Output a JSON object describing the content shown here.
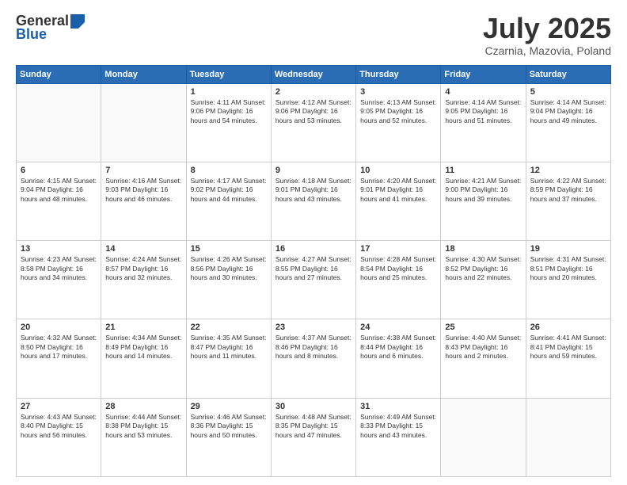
{
  "header": {
    "logo_general": "General",
    "logo_blue": "Blue",
    "title": "July 2025",
    "location": "Czarnia, Mazovia, Poland"
  },
  "calendar": {
    "days": [
      "Sunday",
      "Monday",
      "Tuesday",
      "Wednesday",
      "Thursday",
      "Friday",
      "Saturday"
    ],
    "weeks": [
      [
        {
          "date": "",
          "info": ""
        },
        {
          "date": "",
          "info": ""
        },
        {
          "date": "1",
          "info": "Sunrise: 4:11 AM\nSunset: 9:06 PM\nDaylight: 16 hours\nand 54 minutes."
        },
        {
          "date": "2",
          "info": "Sunrise: 4:12 AM\nSunset: 9:06 PM\nDaylight: 16 hours\nand 53 minutes."
        },
        {
          "date": "3",
          "info": "Sunrise: 4:13 AM\nSunset: 9:05 PM\nDaylight: 16 hours\nand 52 minutes."
        },
        {
          "date": "4",
          "info": "Sunrise: 4:14 AM\nSunset: 9:05 PM\nDaylight: 16 hours\nand 51 minutes."
        },
        {
          "date": "5",
          "info": "Sunrise: 4:14 AM\nSunset: 9:04 PM\nDaylight: 16 hours\nand 49 minutes."
        }
      ],
      [
        {
          "date": "6",
          "info": "Sunrise: 4:15 AM\nSunset: 9:04 PM\nDaylight: 16 hours\nand 48 minutes."
        },
        {
          "date": "7",
          "info": "Sunrise: 4:16 AM\nSunset: 9:03 PM\nDaylight: 16 hours\nand 46 minutes."
        },
        {
          "date": "8",
          "info": "Sunrise: 4:17 AM\nSunset: 9:02 PM\nDaylight: 16 hours\nand 44 minutes."
        },
        {
          "date": "9",
          "info": "Sunrise: 4:18 AM\nSunset: 9:01 PM\nDaylight: 16 hours\nand 43 minutes."
        },
        {
          "date": "10",
          "info": "Sunrise: 4:20 AM\nSunset: 9:01 PM\nDaylight: 16 hours\nand 41 minutes."
        },
        {
          "date": "11",
          "info": "Sunrise: 4:21 AM\nSunset: 9:00 PM\nDaylight: 16 hours\nand 39 minutes."
        },
        {
          "date": "12",
          "info": "Sunrise: 4:22 AM\nSunset: 8:59 PM\nDaylight: 16 hours\nand 37 minutes."
        }
      ],
      [
        {
          "date": "13",
          "info": "Sunrise: 4:23 AM\nSunset: 8:58 PM\nDaylight: 16 hours\nand 34 minutes."
        },
        {
          "date": "14",
          "info": "Sunrise: 4:24 AM\nSunset: 8:57 PM\nDaylight: 16 hours\nand 32 minutes."
        },
        {
          "date": "15",
          "info": "Sunrise: 4:26 AM\nSunset: 8:56 PM\nDaylight: 16 hours\nand 30 minutes."
        },
        {
          "date": "16",
          "info": "Sunrise: 4:27 AM\nSunset: 8:55 PM\nDaylight: 16 hours\nand 27 minutes."
        },
        {
          "date": "17",
          "info": "Sunrise: 4:28 AM\nSunset: 8:54 PM\nDaylight: 16 hours\nand 25 minutes."
        },
        {
          "date": "18",
          "info": "Sunrise: 4:30 AM\nSunset: 8:52 PM\nDaylight: 16 hours\nand 22 minutes."
        },
        {
          "date": "19",
          "info": "Sunrise: 4:31 AM\nSunset: 8:51 PM\nDaylight: 16 hours\nand 20 minutes."
        }
      ],
      [
        {
          "date": "20",
          "info": "Sunrise: 4:32 AM\nSunset: 8:50 PM\nDaylight: 16 hours\nand 17 minutes."
        },
        {
          "date": "21",
          "info": "Sunrise: 4:34 AM\nSunset: 8:49 PM\nDaylight: 16 hours\nand 14 minutes."
        },
        {
          "date": "22",
          "info": "Sunrise: 4:35 AM\nSunset: 8:47 PM\nDaylight: 16 hours\nand 11 minutes."
        },
        {
          "date": "23",
          "info": "Sunrise: 4:37 AM\nSunset: 8:46 PM\nDaylight: 16 hours\nand 8 minutes."
        },
        {
          "date": "24",
          "info": "Sunrise: 4:38 AM\nSunset: 8:44 PM\nDaylight: 16 hours\nand 6 minutes."
        },
        {
          "date": "25",
          "info": "Sunrise: 4:40 AM\nSunset: 8:43 PM\nDaylight: 16 hours\nand 2 minutes."
        },
        {
          "date": "26",
          "info": "Sunrise: 4:41 AM\nSunset: 8:41 PM\nDaylight: 15 hours\nand 59 minutes."
        }
      ],
      [
        {
          "date": "27",
          "info": "Sunrise: 4:43 AM\nSunset: 8:40 PM\nDaylight: 15 hours\nand 56 minutes."
        },
        {
          "date": "28",
          "info": "Sunrise: 4:44 AM\nSunset: 8:38 PM\nDaylight: 15 hours\nand 53 minutes."
        },
        {
          "date": "29",
          "info": "Sunrise: 4:46 AM\nSunset: 8:36 PM\nDaylight: 15 hours\nand 50 minutes."
        },
        {
          "date": "30",
          "info": "Sunrise: 4:48 AM\nSunset: 8:35 PM\nDaylight: 15 hours\nand 47 minutes."
        },
        {
          "date": "31",
          "info": "Sunrise: 4:49 AM\nSunset: 8:33 PM\nDaylight: 15 hours\nand 43 minutes."
        },
        {
          "date": "",
          "info": ""
        },
        {
          "date": "",
          "info": ""
        }
      ]
    ]
  }
}
